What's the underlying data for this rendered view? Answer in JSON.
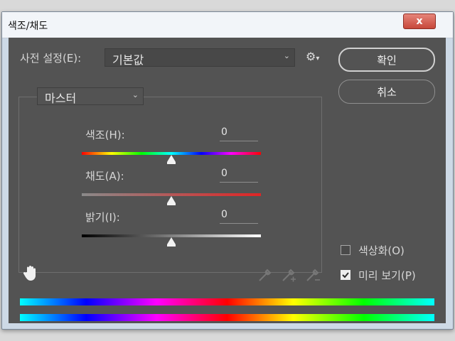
{
  "window": {
    "title": "색조/채도",
    "close_label": "x"
  },
  "preset": {
    "label": "사전 설정(E):",
    "value": "기본값"
  },
  "buttons": {
    "ok_label": "확인",
    "cancel_label": "취소"
  },
  "channel": {
    "value": "마스터"
  },
  "sliders": [
    {
      "label": "색조(H):",
      "value": "0",
      "position": 0.5
    },
    {
      "label": "채도(A):",
      "value": "0",
      "position": 0.5
    },
    {
      "label": "밝기(I):",
      "value": "0",
      "position": 0.5
    }
  ],
  "options": {
    "colorize_label": "색상화(O)",
    "colorize_checked": false,
    "preview_label": "미리 보기(P)",
    "preview_checked": true
  },
  "colors": {
    "panel_bg": "#535353",
    "accent": "#e0493f"
  }
}
